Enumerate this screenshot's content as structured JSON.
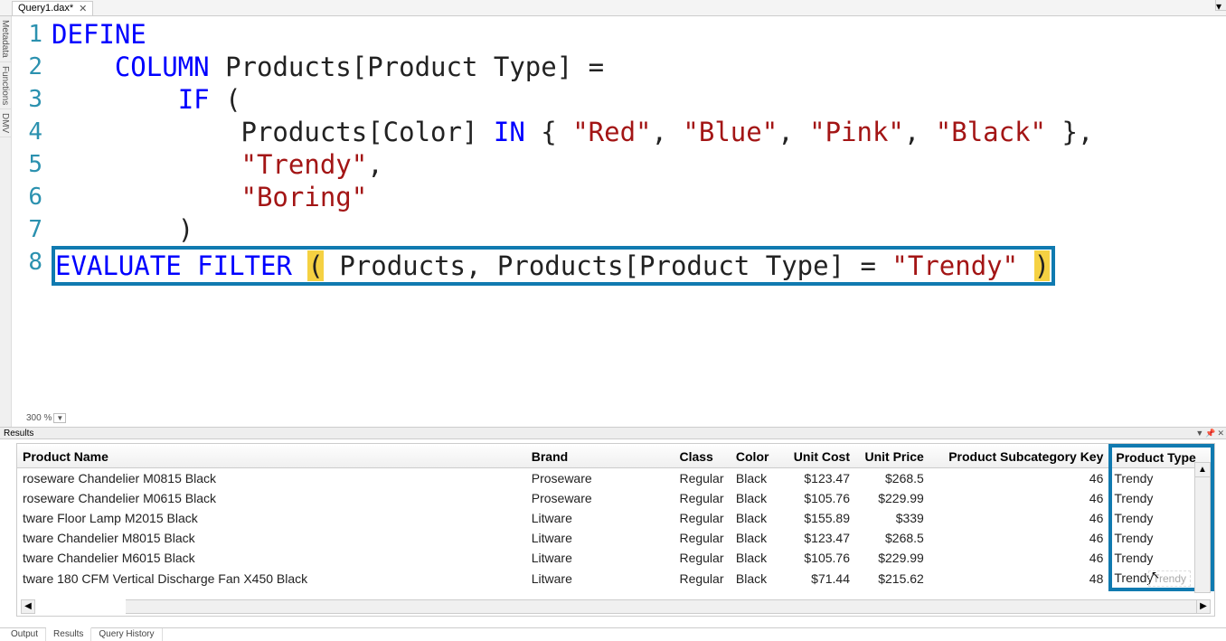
{
  "tab": {
    "title": "Query1.dax*",
    "close": "✕"
  },
  "sidebar": {
    "metadata": "Metadata",
    "functions": "Functions",
    "dmv": "DMV"
  },
  "editor": {
    "lines": [
      {
        "n": "1",
        "tokens": [
          [
            "kw",
            "DEFINE"
          ]
        ]
      },
      {
        "n": "2",
        "tokens": [
          [
            "sp",
            "    "
          ],
          [
            "kw",
            "COLUMN"
          ],
          [
            "sp",
            " "
          ],
          [
            "id",
            "Products[Product Type] ="
          ]
        ]
      },
      {
        "n": "3",
        "tokens": [
          [
            "sp",
            "        "
          ],
          [
            "kw",
            "IF"
          ],
          [
            "sp",
            " "
          ],
          [
            "pun",
            "("
          ]
        ]
      },
      {
        "n": "4",
        "tokens": [
          [
            "sp",
            "            "
          ],
          [
            "id",
            "Products[Color] "
          ],
          [
            "kw",
            "IN"
          ],
          [
            "sp",
            " "
          ],
          [
            "pun",
            "{ "
          ],
          [
            "str",
            "\"Red\""
          ],
          [
            "pun",
            ", "
          ],
          [
            "str",
            "\"Blue\""
          ],
          [
            "pun",
            ", "
          ],
          [
            "str",
            "\"Pink\""
          ],
          [
            "pun",
            ", "
          ],
          [
            "str",
            "\"Black\""
          ],
          [
            "pun",
            " },"
          ]
        ]
      },
      {
        "n": "5",
        "tokens": [
          [
            "sp",
            "            "
          ],
          [
            "str",
            "\"Trendy\""
          ],
          [
            "pun",
            ","
          ]
        ]
      },
      {
        "n": "6",
        "tokens": [
          [
            "sp",
            "            "
          ],
          [
            "str",
            "\"Boring\""
          ]
        ]
      },
      {
        "n": "7",
        "tokens": [
          [
            "sp",
            "        "
          ],
          [
            "pun",
            ")"
          ]
        ]
      },
      {
        "n": "8",
        "tokens": [
          [
            "kw",
            "EVALUATE"
          ],
          [
            "sp",
            " "
          ],
          [
            "kw",
            "FILTER"
          ],
          [
            "sp",
            " "
          ],
          [
            "hlp",
            "("
          ],
          [
            "sp",
            " "
          ],
          [
            "id",
            "Products, Products[Product Type] = "
          ],
          [
            "str",
            "\"Trendy\""
          ],
          [
            "sp",
            " "
          ],
          [
            "hlp",
            ")"
          ]
        ]
      }
    ]
  },
  "zoom": "300 %",
  "results_title": "Results",
  "grid": {
    "headers": [
      "Product Name",
      "Brand",
      "Class",
      "Color",
      "Unit Cost",
      "Unit Price",
      "Product Subcategory Key",
      "Product Type"
    ],
    "rows": [
      [
        "roseware Chandelier M0815 Black",
        "Proseware",
        "Regular",
        "Black",
        "$123.47",
        "$268.5",
        "46",
        "Trendy"
      ],
      [
        "roseware Chandelier M0615 Black",
        "Proseware",
        "Regular",
        "Black",
        "$105.76",
        "$229.99",
        "46",
        "Trendy"
      ],
      [
        "tware Floor Lamp M2015 Black",
        "Litware",
        "Regular",
        "Black",
        "$155.89",
        "$339",
        "46",
        "Trendy"
      ],
      [
        "tware Chandelier M8015 Black",
        "Litware",
        "Regular",
        "Black",
        "$123.47",
        "$268.5",
        "46",
        "Trendy"
      ],
      [
        "tware Chandelier M6015 Black",
        "Litware",
        "Regular",
        "Black",
        "$105.76",
        "$229.99",
        "46",
        "Trendy"
      ],
      [
        "tware 180 CFM Vertical Discharge Fan X450 Black",
        "Litware",
        "Regular",
        "Black",
        "$71.44",
        "$215.62",
        "48",
        "Trendy"
      ]
    ]
  },
  "bottom": {
    "output": "Output",
    "results": "Results",
    "history": "Query History"
  },
  "scroll_tooltip": "Trendy"
}
